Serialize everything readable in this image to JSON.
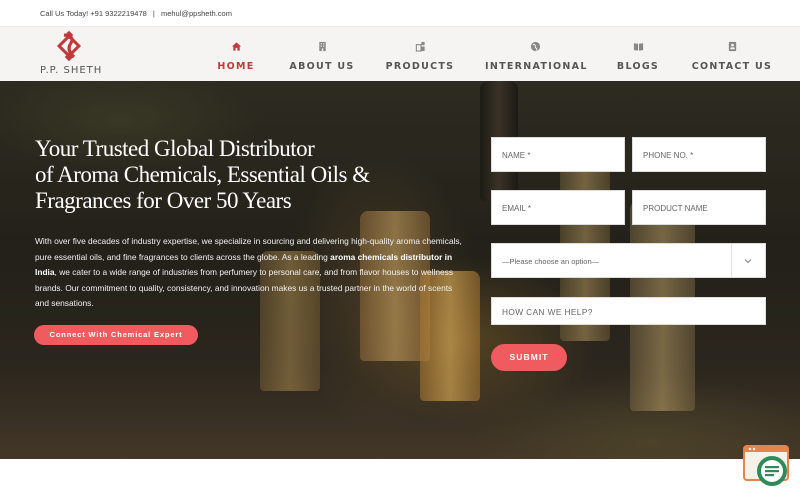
{
  "topbar": {
    "phone": "Call Us Today! +91 9322219478",
    "separator": "|",
    "email": "mehul@ppsheth.com"
  },
  "brand": {
    "logo_text": "P.P. SHETH",
    "logo_color": "#c0393b"
  },
  "nav": {
    "items": [
      {
        "label": "HOME",
        "icon": "home-icon",
        "active": true
      },
      {
        "label": "ABOUT US",
        "icon": "building-icon",
        "active": false
      },
      {
        "label": "PRODUCTS",
        "icon": "products-icon",
        "active": false
      },
      {
        "label": "INTERNATIONAL",
        "icon": "globe-icon",
        "active": false
      },
      {
        "label": "BLOGS",
        "icon": "book-icon",
        "active": false
      },
      {
        "label": "CONTACT US",
        "icon": "contact-card-icon",
        "active": false
      }
    ]
  },
  "hero": {
    "title_line1": "Your Trusted Global Distributor",
    "title_line2": "of Aroma Chemicals, Essential Oils &",
    "title_line3": "Fragrances for Over 50 Years",
    "text_1": "With over five decades of industry expertise, we specialize in sourcing and delivering high-quality aroma chemicals, pure essential oils, and fine fragrances to clients across the globe. As a leading ",
    "text_bold": "aroma chemicals distributor in India",
    "text_2": ", we cater to a wide range of industries from perfumery to personal care, and from flavor houses to wellness brands. Our commitment to quality, consistency, and innovation makes us a trusted partner in the world of scents and sensations.",
    "cta_label": "Connect With Chemical Expert"
  },
  "form": {
    "name_placeholder": "NAME *",
    "phone_placeholder": "PHONE NO. *",
    "email_placeholder": "EMAIL *",
    "product_placeholder": "PRODUCT NAME",
    "select_value": "—Please choose an option—",
    "help_placeholder": "HOW CAN WE HELP?",
    "submit_label": "SUBMIT"
  },
  "colors": {
    "accent": "#ef5b5f",
    "nav_active": "#c0393b"
  },
  "widgets": {
    "chat_icon": "chat-support-icon"
  }
}
